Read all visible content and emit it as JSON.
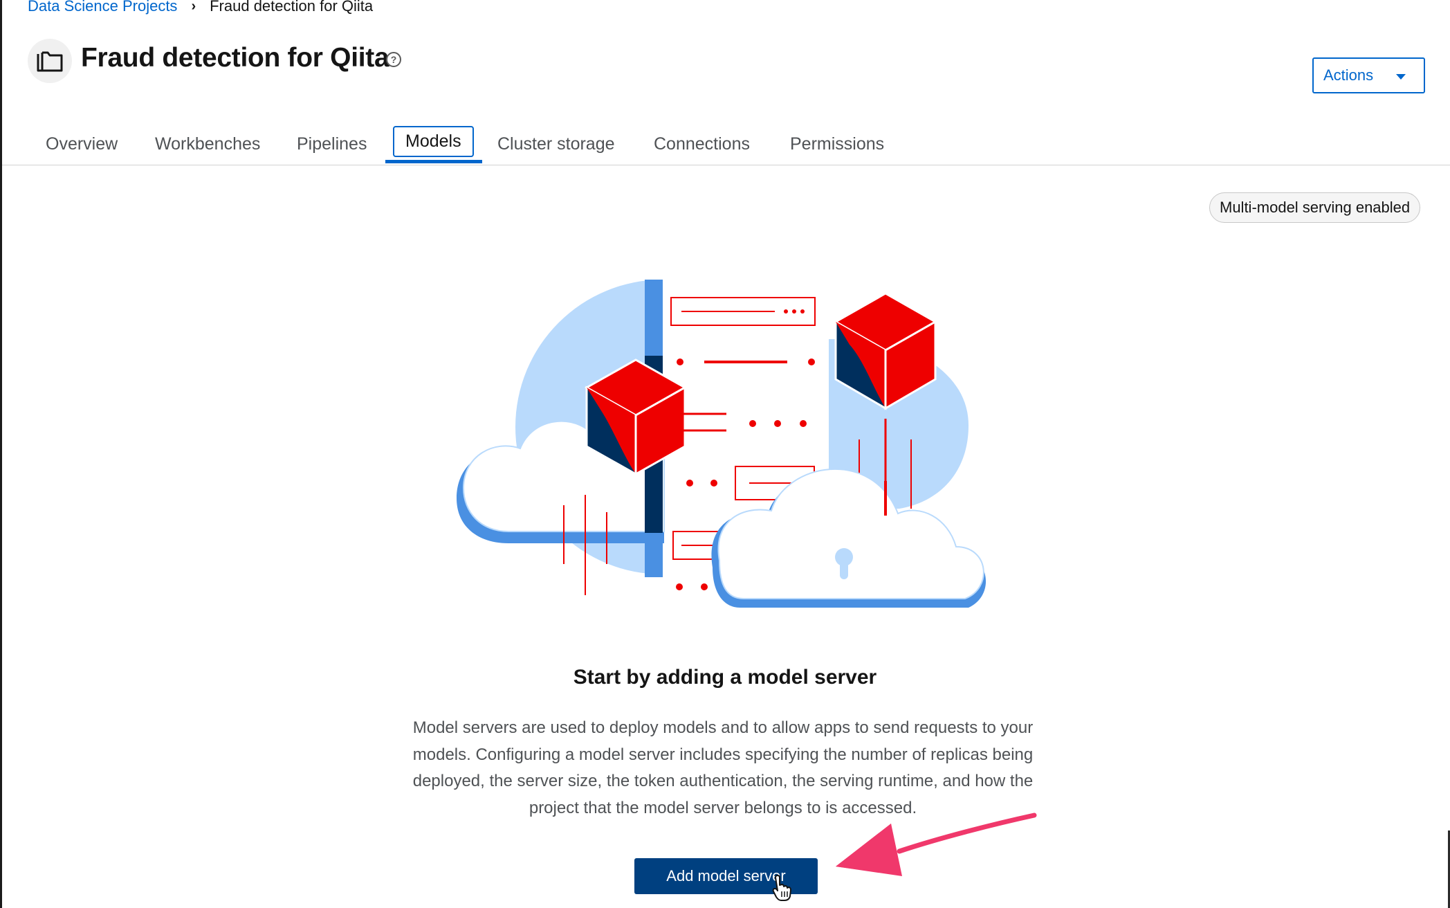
{
  "breadcrumb": {
    "parent": "Data Science Projects",
    "current": "Fraud detection for Qiita"
  },
  "header": {
    "title": "Fraud detection for Qiita",
    "help_glyph": "?",
    "actions_label": "Actions"
  },
  "tabs": [
    {
      "label": "Overview"
    },
    {
      "label": "Workbenches"
    },
    {
      "label": "Pipelines"
    },
    {
      "label": "Models",
      "active": true
    },
    {
      "label": "Cluster storage"
    },
    {
      "label": "Connections"
    },
    {
      "label": "Permissions"
    }
  ],
  "badge": "Multi-model serving enabled",
  "empty_state": {
    "title": "Start by adding a model server",
    "body": "Model servers are used to deploy models and to allow apps to send requests to your models. Configuring a model server includes specifying the number of replicas being deployed, the server size, the token authentication, the serving runtime, and how the project that the model server belongs to is accessed.",
    "button_label": "Add model server"
  },
  "colors": {
    "link": "#0066cc",
    "primary_button": "#004080",
    "accent_red": "#ee0000",
    "cloud_blue": "#b9dafc",
    "arrow_pink": "#f0386b"
  }
}
